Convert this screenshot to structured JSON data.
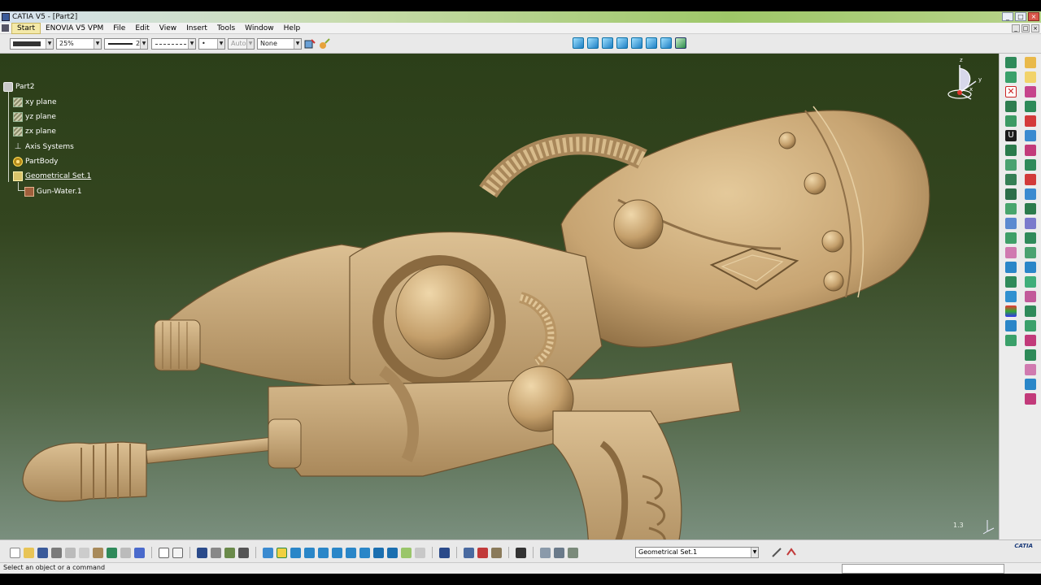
{
  "window": {
    "title": "CATIA V5 - [Part2]",
    "controls": [
      "_",
      "□",
      "×"
    ]
  },
  "menubar": {
    "items": [
      "Start",
      "ENOVIA V5 VPM",
      "File",
      "Edit",
      "View",
      "Insert",
      "Tools",
      "Window",
      "Help"
    ]
  },
  "graphic_properties": {
    "zoom_value": "25%",
    "line_weight": "2",
    "point_style": "•",
    "layer_value": "Auto",
    "render_value": "None"
  },
  "tree": {
    "root": "Part2",
    "items": [
      {
        "label": "xy plane",
        "icon": "plane-icon"
      },
      {
        "label": "yz plane",
        "icon": "plane-icon"
      },
      {
        "label": "zx plane",
        "icon": "plane-icon"
      },
      {
        "label": "Axis Systems",
        "icon": "axis-icon"
      },
      {
        "label": "PartBody",
        "icon": "gear-icon"
      },
      {
        "label": "Geometrical Set.1",
        "icon": "geoset-icon"
      },
      {
        "label": "Gun-Water.1",
        "icon": "surface-icon"
      }
    ]
  },
  "viewport": {
    "scale_label": "1.3",
    "compass_labels": {
      "z": "z",
      "y": "y",
      "x": "x"
    }
  },
  "bottom": {
    "active_set": "Geometrical Set.1",
    "logo_text": "CATIA"
  },
  "status": {
    "prompt": "Select an object or a command"
  },
  "colors": {
    "viewport_top": "#2c3f19",
    "viewport_bottom": "#7a8f7e",
    "model_color": "#c9a877"
  }
}
